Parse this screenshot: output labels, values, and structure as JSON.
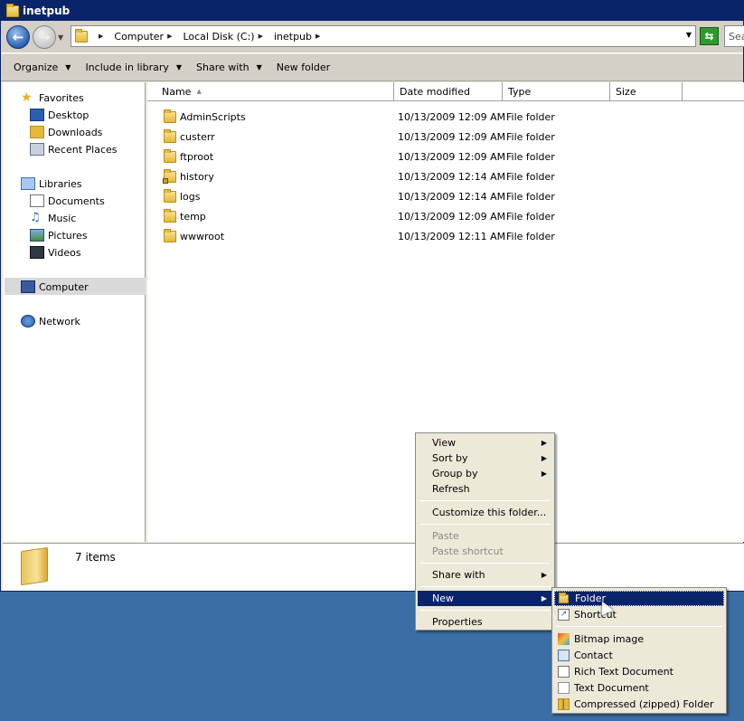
{
  "window": {
    "title": "inetpub"
  },
  "address": {
    "crumbs": [
      "Computer",
      "Local Disk (C:)",
      "inetpub"
    ],
    "search_placeholder": "Sea"
  },
  "toolbar": {
    "organize": "Organize",
    "include": "Include in library",
    "share": "Share with",
    "new_folder": "New folder"
  },
  "nav": {
    "favorites": "Favorites",
    "desktop": "Desktop",
    "downloads": "Downloads",
    "recent": "Recent Places",
    "libraries": "Libraries",
    "documents": "Documents",
    "music": "Music",
    "pictures": "Pictures",
    "videos": "Videos",
    "computer": "Computer",
    "network": "Network"
  },
  "columns": {
    "name": "Name",
    "date": "Date modified",
    "type": "Type",
    "size": "Size"
  },
  "files": [
    {
      "name": "AdminScripts",
      "date": "10/13/2009 12:09 AM",
      "type": "File folder",
      "locked": false
    },
    {
      "name": "custerr",
      "date": "10/13/2009 12:09 AM",
      "type": "File folder",
      "locked": false
    },
    {
      "name": "ftproot",
      "date": "10/13/2009 12:09 AM",
      "type": "File folder",
      "locked": false
    },
    {
      "name": "history",
      "date": "10/13/2009 12:14 AM",
      "type": "File folder",
      "locked": true
    },
    {
      "name": "logs",
      "date": "10/13/2009 12:14 AM",
      "type": "File folder",
      "locked": false
    },
    {
      "name": "temp",
      "date": "10/13/2009 12:09 AM",
      "type": "File folder",
      "locked": false
    },
    {
      "name": "wwwroot",
      "date": "10/13/2009 12:11 AM",
      "type": "File folder",
      "locked": false
    }
  ],
  "status": {
    "count": "7 items"
  },
  "context_menu": {
    "view": "View",
    "sort_by": "Sort by",
    "group_by": "Group by",
    "refresh": "Refresh",
    "customize": "Customize this folder...",
    "paste": "Paste",
    "paste_shortcut": "Paste shortcut",
    "share_with": "Share with",
    "new": "New",
    "properties": "Properties"
  },
  "new_submenu": {
    "folder": "Folder",
    "shortcut": "Shortcut",
    "bitmap": "Bitmap image",
    "contact": "Contact",
    "rtf": "Rich Text Document",
    "text": "Text Document",
    "zip": "Compressed (zipped) Folder"
  }
}
